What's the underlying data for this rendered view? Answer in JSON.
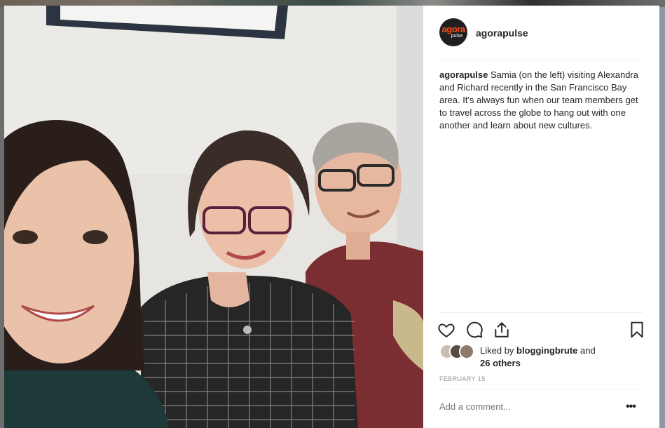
{
  "post": {
    "account": {
      "username": "agorapulse",
      "avatar_text_top": "agora",
      "avatar_text_bottom": "pulse"
    },
    "caption": {
      "username": "agorapulse",
      "text": "Samia (on the left) visiting Alexandra and Richard recently in the San Francisco Bay area. It's always fun when our team members get to travel across the globe to hang out with one another and learn about new cultures."
    },
    "likes": {
      "prefix": "Liked by",
      "user": "bloggingbrute",
      "suffix": "and",
      "others": "26 others"
    },
    "date": "FEBRUARY 15",
    "comment": {
      "placeholder": "Add a comment..."
    }
  },
  "icons": {
    "like": "heart-icon",
    "comment": "comment-bubble-icon",
    "share": "share-icon",
    "save": "bookmark-icon",
    "more": "more-options-icon"
  },
  "colors": {
    "text": "#262626",
    "muted": "#999999",
    "divider": "#efefef",
    "brand": "#ff4e17"
  }
}
